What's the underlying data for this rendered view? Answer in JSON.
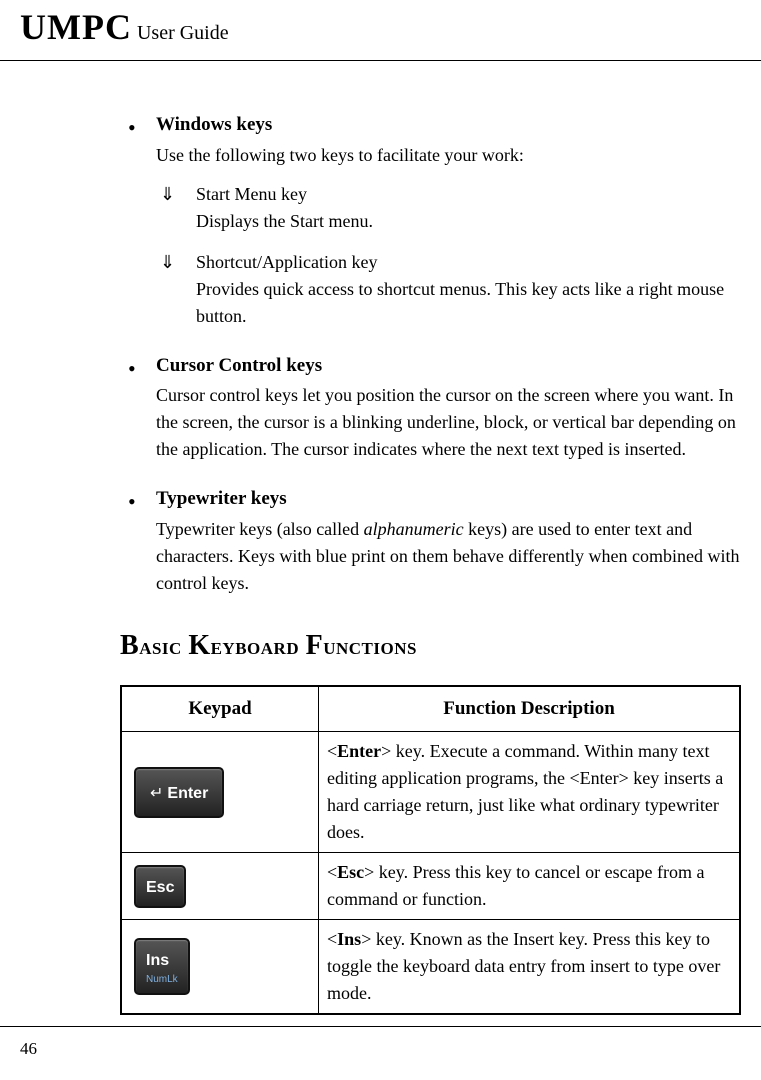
{
  "header": {
    "title_big": "UMPC",
    "title_small": " User Guide"
  },
  "bullets": [
    {
      "title": "Windows keys",
      "body": "Use the following two keys to facilitate your work:",
      "subitems": [
        {
          "label": "Start Menu key",
          "desc": "Displays the Start menu."
        },
        {
          "label": "Shortcut/Application key",
          "desc": "Provides quick access to shortcut menus. This key acts like a right mouse button."
        }
      ]
    },
    {
      "title": "Cursor Control keys",
      "body": "Cursor control keys let you position the cursor on the screen where you want. In the screen, the cursor is a blinking underline, block, or vertical bar depending on the application. The cursor indicates where the next text typed is inserted."
    },
    {
      "title": "Typewriter keys",
      "body_pre": "Typewriter keys (also called ",
      "body_italic": "alphanumeric",
      "body_post": " keys) are used to enter text and characters. Keys with blue print on them behave differently when combined with control keys."
    }
  ],
  "section_heading": "Basic Keyboard Functions",
  "table": {
    "header_keypad": "Keypad",
    "header_function": "Function Description",
    "rows": [
      {
        "key_main": "Enter",
        "key_sub": "",
        "key_arrow": "↵",
        "desc_pre": "<",
        "desc_bold": "Enter",
        "desc_post": "> key. Execute a command. Within many text editing application programs, the <Enter> key inserts a hard carriage return, just like what ordinary typewriter does."
      },
      {
        "key_main": "Esc",
        "key_sub": "",
        "key_arrow": "",
        "desc_pre": "<",
        "desc_bold": "Esc",
        "desc_post": "> key. Press this key to cancel or escape from a command or function."
      },
      {
        "key_main": "Ins",
        "key_sub": "NumLk",
        "key_arrow": "",
        "desc_pre": "<",
        "desc_bold": "Ins",
        "desc_post": "> key. Known as the Insert key. Press this key to toggle the keyboard data entry from insert to type over mode."
      }
    ]
  },
  "page_number": "46"
}
